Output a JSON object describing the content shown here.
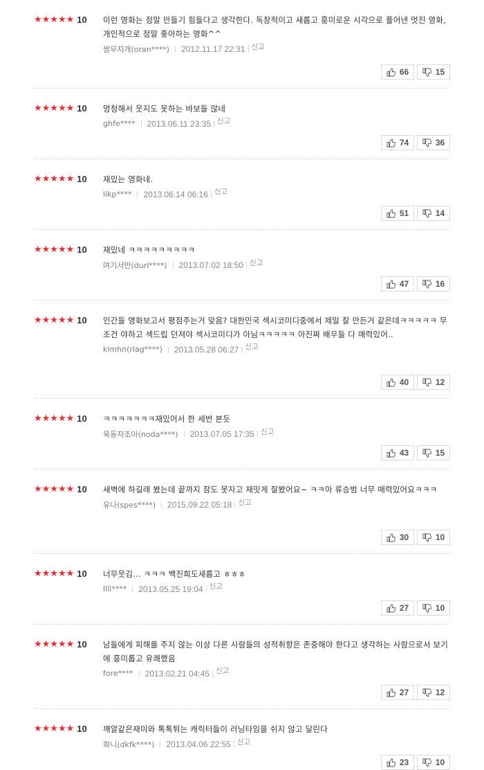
{
  "reviews": [
    {
      "stars": "★★★★★",
      "score": "10",
      "text": "이런 영화는 정말 만들기 힘들다고 생각한다. 독창적이고 새롭고 흥미로운 시각으로 풀어낸 멋진 영화, 개인적으로 정말 좋아하는 영화^^",
      "user": "쌍무지개(oran****)",
      "date": "2012.11.17 22:31",
      "report": "신고",
      "likes": "66",
      "dislikes": "15"
    },
    {
      "stars": "★★★★★",
      "score": "10",
      "text": "멍청해서 웃지도 못하는 바보들 많네",
      "user": "ghfe****",
      "date": "2013.06.11 23:35",
      "report": "신고",
      "likes": "74",
      "dislikes": "36"
    },
    {
      "stars": "★★★★★",
      "score": "10",
      "text": "재밌는 영화네.",
      "user": "likp****",
      "date": "2013.06.14 06:16",
      "report": "신고",
      "likes": "51",
      "dislikes": "14"
    },
    {
      "stars": "★★★★★",
      "score": "10",
      "text": "재밌네 ㅋㅋㅋㅋㅋㅋㅋㅋㅋ",
      "user": "여기서만(durl****)",
      "date": "2013.07.02 18:50",
      "report": "신고",
      "likes": "47",
      "dislikes": "16"
    },
    {
      "stars": "★★★★★",
      "score": "10",
      "text": "인간들 영화보고서 평점주는거 맞음? 대한민국 섹시코미디중에서 제일 잘 만든거 같은데ㅋㅋㅋㅋㅋ 무조건 야하고 섹드립 던져야 섹시코미디가 아님ㅋㅋㅋㅋㅋ 아진짜 배우들 다 매력있어..",
      "user": "kimhn(rlag****)",
      "date": "2013.05.28 06:27",
      "report": "신고",
      "likes": "40",
      "dislikes": "12"
    },
    {
      "stars": "★★★★★",
      "score": "10",
      "text": "ㅋㅋㅋㅋㅋㅋㅋ재밌어서 한 세번 본듯",
      "user": "옥동자조아(noda****)",
      "date": "2013.07.05 17:35",
      "report": "신고",
      "likes": "43",
      "dislikes": "15"
    },
    {
      "stars": "★★★★★",
      "score": "10",
      "text": "새벽에 하길래 봤는데 끝까지 잠도 못자고 재밋게 잘봤어요~ ㅋㅋ아 류승범 너무 매력있어요ㅋㅋㅋ",
      "user": "유나(spes****)",
      "date": "2015.09.22 05:18",
      "report": "신고",
      "likes": "30",
      "dislikes": "10"
    },
    {
      "stars": "★★★★★",
      "score": "10",
      "text": "너무웃김... ㅋㅋㅋ 백진희도새롭고 ㅎㅎㅎ",
      "user": "llll****",
      "date": "2013.05.25 19:04",
      "report": "신고",
      "likes": "27",
      "dislikes": "10"
    },
    {
      "stars": "★★★★★",
      "score": "10",
      "text": "남들에게 피해를 주지 않는 이상 다른 사람들의 성적취향은 존중해야 한다고 생각하는 사람으로서 보기에 흥미롭고 유쾌했음",
      "user": "fore****",
      "date": "2013.02.21 04:45",
      "report": "신고",
      "likes": "27",
      "dislikes": "12"
    },
    {
      "stars": "★★★★★",
      "score": "10",
      "text": "깨알같은재미와 톡톡튀는 캐릭터들이 러닝타임을 쉬지 않고 달린다",
      "user": "화니(dkfk****)",
      "date": "2013.04.06 22:55",
      "report": "신고",
      "likes": "23",
      "dislikes": "10"
    }
  ]
}
